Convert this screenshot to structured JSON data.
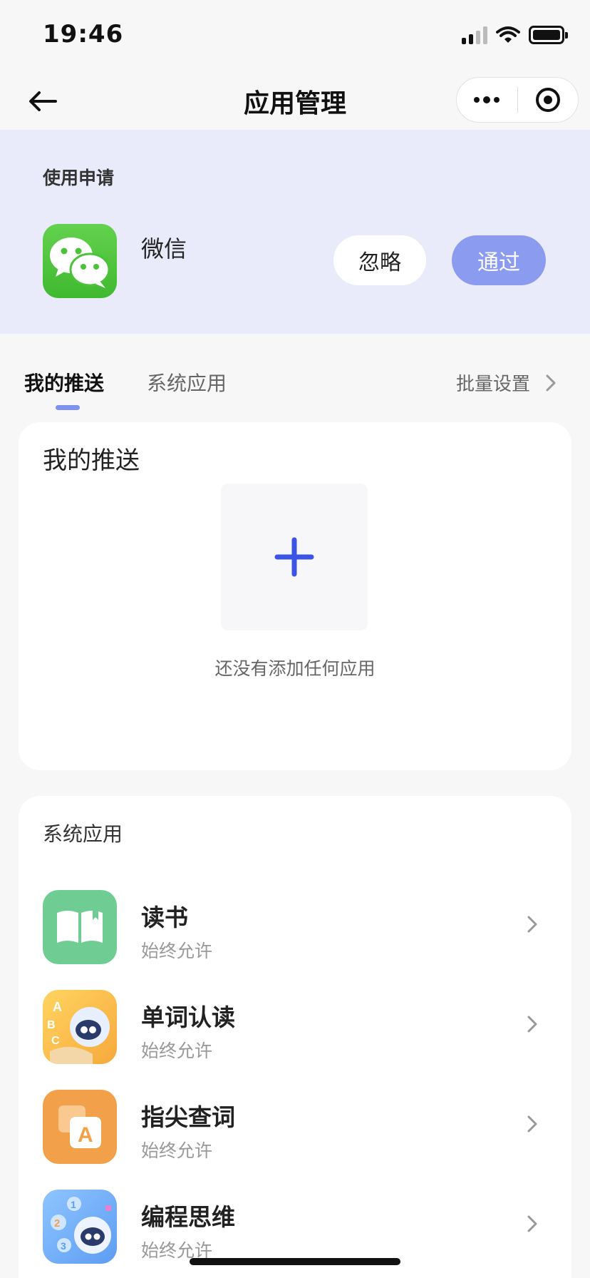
{
  "status_bar": {
    "time": "19:46"
  },
  "nav": {
    "title": "应用管理"
  },
  "request": {
    "section_title": "使用申请",
    "app_name": "微信",
    "ignore_label": "忽略",
    "pass_label": "通过"
  },
  "tabs": {
    "items": [
      {
        "label": "我的推送",
        "active": true
      },
      {
        "label": "系统应用",
        "active": false
      }
    ],
    "batch_label": "批量设置"
  },
  "my_push": {
    "title": "我的推送",
    "empty_tip": "还没有添加任何应用"
  },
  "system_apps": {
    "title": "系统应用",
    "items": [
      {
        "name": "读书",
        "status": "始终允许",
        "icon": "book-app-icon"
      },
      {
        "name": "单词认读",
        "status": "始终允许",
        "icon": "word-reading-app-icon"
      },
      {
        "name": "指尖查词",
        "status": "始终允许",
        "icon": "fingertip-lookup-app-icon"
      },
      {
        "name": "编程思维",
        "status": "始终允许",
        "icon": "coding-thinking-app-icon"
      }
    ]
  },
  "colors": {
    "accent": "#8b9cf0",
    "request_bg": "#e9ebfb",
    "plus": "#3a55e6",
    "wechat_green": "#4cc23a"
  }
}
